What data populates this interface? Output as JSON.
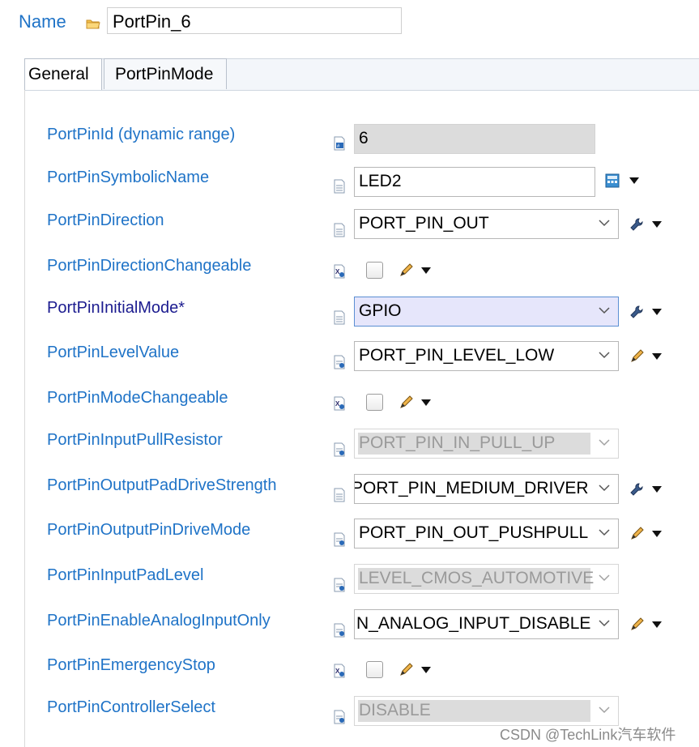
{
  "name_row": {
    "label": "Name",
    "value": "PortPin_6"
  },
  "tabs": [
    {
      "label": "General"
    },
    {
      "label": "PortPinMode"
    }
  ],
  "params": [
    {
      "label": "PortPinId (dynamic range)",
      "value": "6"
    },
    {
      "label": "PortPinSymbolicName",
      "value": "LED2"
    },
    {
      "label": "PortPinDirection",
      "value": "PORT_PIN_OUT"
    },
    {
      "label": "PortPinDirectionChangeable",
      "value": ""
    },
    {
      "label": "PortPinInitialMode*",
      "value": "GPIO"
    },
    {
      "label": "PortPinLevelValue",
      "value": "PORT_PIN_LEVEL_LOW"
    },
    {
      "label": "PortPinModeChangeable",
      "value": ""
    },
    {
      "label": "PortPinInputPullResistor",
      "value": "PORT_PIN_IN_PULL_UP"
    },
    {
      "label": "PortPinOutputPadDriveStrength",
      "value": "PORT_PIN_MEDIUM_DRIVER"
    },
    {
      "label": "PortPinOutputPinDriveMode",
      "value": "PORT_PIN_OUT_PUSHPULL"
    },
    {
      "label": "PortPinInputPadLevel",
      "value": "LEVEL_CMOS_AUTOMOTIVE"
    },
    {
      "label": "PortPinEnableAnalogInputOnly",
      "value": "N_ANALOG_INPUT_DISABLE"
    },
    {
      "label": "PortPinEmergencyStop",
      "value": ""
    },
    {
      "label": "PortPinControllerSelect",
      "value": "DISABLE"
    }
  ],
  "watermark": "CSDN @TechLink汽车软件",
  "colors": {
    "label": "#1f73c7",
    "required_label": "#1b1b8f",
    "readonly_bg": "#dcdcdc",
    "focus_bg": "#e6e6fb"
  }
}
